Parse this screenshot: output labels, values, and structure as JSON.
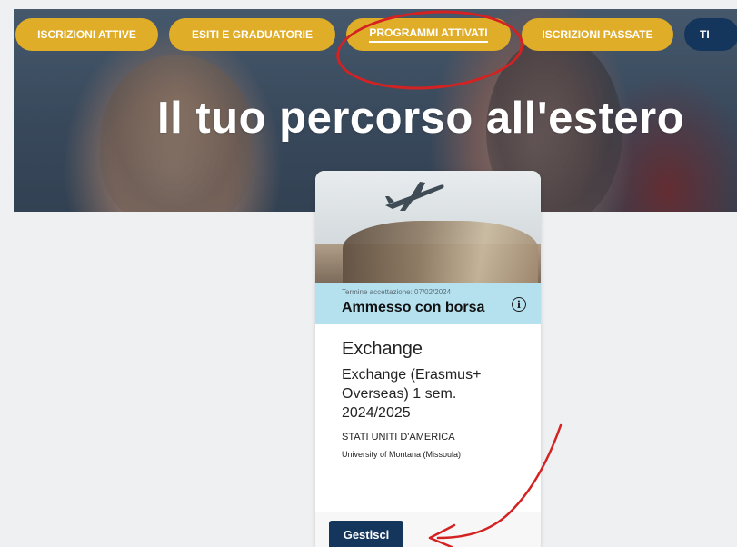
{
  "tabs": [
    {
      "label": "ISCRIZIONI ATTIVE"
    },
    {
      "label": "ESITI E GRADUATORIE"
    },
    {
      "label": "PROGRAMMI ATTIVATI"
    },
    {
      "label": "ISCRIZIONI PASSATE"
    },
    {
      "label": "TI"
    }
  ],
  "hero": {
    "title": "Il tuo percorso all'estero"
  },
  "card": {
    "deadline": "Termine accettazione: 07/02/2024",
    "status": "Ammesso con borsa",
    "type": "Exchange",
    "program": "Exchange (Erasmus+ Overseas) 1 sem. 2024/2025",
    "country": "STATI UNITI D'AMERICA",
    "university": "University of Montana (Missoula)",
    "button": "Gestisci"
  },
  "colors": {
    "tab": "#e0ad28",
    "dark": "#15365c",
    "status_bg": "#b5e1ef",
    "annotation": "#d42222"
  }
}
